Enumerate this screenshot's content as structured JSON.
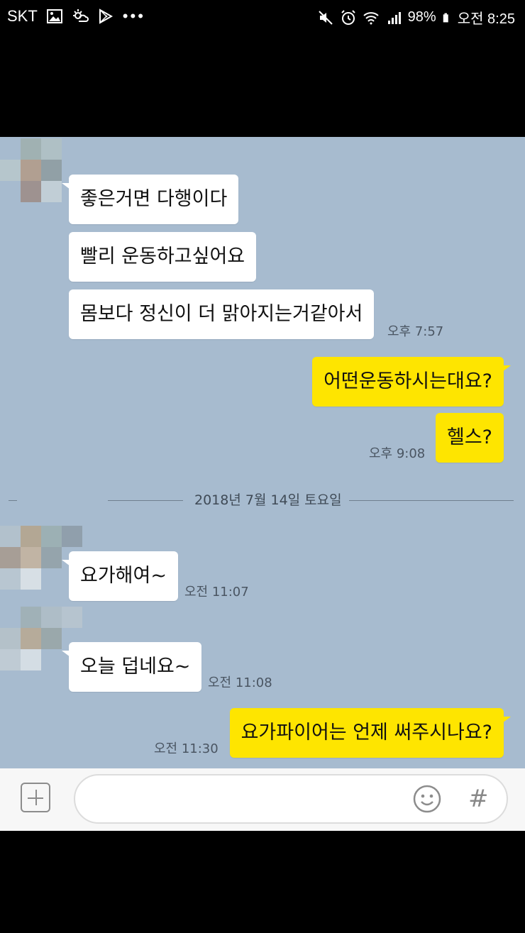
{
  "status_bar": {
    "carrier": "SKT",
    "battery": "98%",
    "time": "오전 8:25",
    "left_icons": [
      "image-icon",
      "weather-icon",
      "play-store-icon",
      "more-dots-icon"
    ],
    "right_icons": [
      "mute-icon",
      "alarm-icon",
      "wifi-icon",
      "signal-icon",
      "battery-icon"
    ]
  },
  "chat": {
    "background": "#a7bbcf",
    "bubble_in_color": "#ffffff",
    "bubble_out_color": "#fee500",
    "messages": [
      {
        "side": "in",
        "text": "좋은거면 다행이다",
        "time": ""
      },
      {
        "side": "in",
        "text": "빨리 운동하고싶어요",
        "time": ""
      },
      {
        "side": "in",
        "text": "몸보다 정신이 더 맑아지는거같아서",
        "time": "오후 7:57"
      },
      {
        "side": "out",
        "text": "어떤운동하시는대요?",
        "time": ""
      },
      {
        "side": "out",
        "text": "헬스?",
        "time": "오후 9:08"
      },
      {
        "side": "in",
        "text": "요가해여~",
        "time": "오전 11:07"
      },
      {
        "side": "in",
        "text": "오늘 덥네요~",
        "time": "오전 11:08"
      },
      {
        "side": "out",
        "text": "요가파이어는 언제 써주시나요?",
        "time": "오전 11:30"
      }
    ],
    "date_separator": "2018년 7월 14일 토요일"
  },
  "input_bar": {
    "plus_icon": "plus-icon",
    "emoji_icon": "emoji-icon",
    "hash_label": "#"
  }
}
